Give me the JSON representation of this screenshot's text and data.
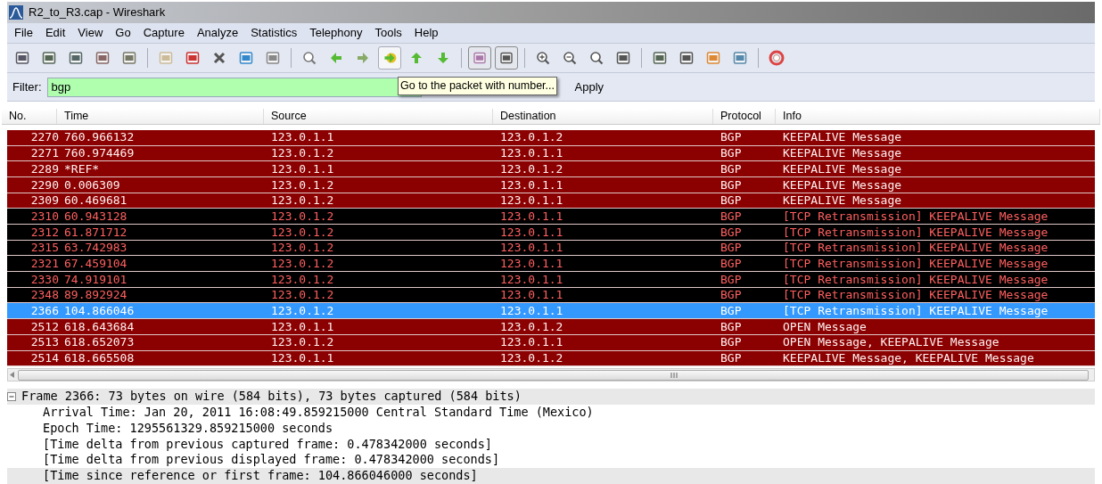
{
  "window": {
    "title": "R2_to_R3.cap - Wireshark"
  },
  "menu": [
    "File",
    "Edit",
    "View",
    "Go",
    "Capture",
    "Analyze",
    "Statistics",
    "Telephony",
    "Tools",
    "Help"
  ],
  "filter": {
    "label": "Filter:",
    "value": "bgp",
    "apply": "Apply"
  },
  "tooltip": "Go to the packet with number...",
  "columns": [
    "No.",
    "Time",
    "Source",
    "Destination",
    "Protocol",
    "Info"
  ],
  "rows": [
    {
      "kind": "normal",
      "selected": false,
      "cells": [
        "2270",
        "760.966132",
        "123.0.1.1",
        "123.0.1.2",
        "BGP",
        "KEEPALIVE Message"
      ]
    },
    {
      "kind": "normal",
      "selected": false,
      "cells": [
        "2271",
        "760.974469",
        "123.0.1.2",
        "123.0.1.1",
        "BGP",
        "KEEPALIVE Message"
      ]
    },
    {
      "kind": "normal",
      "selected": false,
      "cells": [
        "2289",
        "*REF*",
        "123.0.1.1",
        "123.0.1.2",
        "BGP",
        "KEEPALIVE Message"
      ]
    },
    {
      "kind": "normal",
      "selected": false,
      "cells": [
        "2290",
        "0.006309",
        "123.0.1.2",
        "123.0.1.1",
        "BGP",
        "KEEPALIVE Message"
      ]
    },
    {
      "kind": "normal",
      "selected": false,
      "cells": [
        "2309",
        "60.469681",
        "123.0.1.2",
        "123.0.1.1",
        "BGP",
        "KEEPALIVE Message"
      ]
    },
    {
      "kind": "error",
      "selected": false,
      "cells": [
        "2310",
        "60.943128",
        "123.0.1.2",
        "123.0.1.1",
        "BGP",
        "[TCP Retransmission] KEEPALIVE Message"
      ]
    },
    {
      "kind": "error",
      "selected": false,
      "cells": [
        "2312",
        "61.871712",
        "123.0.1.2",
        "123.0.1.1",
        "BGP",
        "[TCP Retransmission] KEEPALIVE Message"
      ]
    },
    {
      "kind": "error",
      "selected": false,
      "cells": [
        "2315",
        "63.742983",
        "123.0.1.2",
        "123.0.1.1",
        "BGP",
        "[TCP Retransmission] KEEPALIVE Message"
      ]
    },
    {
      "kind": "error",
      "selected": false,
      "cells": [
        "2321",
        "67.459104",
        "123.0.1.2",
        "123.0.1.1",
        "BGP",
        "[TCP Retransmission] KEEPALIVE Message"
      ]
    },
    {
      "kind": "error",
      "selected": false,
      "cells": [
        "2330",
        "74.919101",
        "123.0.1.2",
        "123.0.1.1",
        "BGP",
        "[TCP Retransmission] KEEPALIVE Message"
      ]
    },
    {
      "kind": "error",
      "selected": false,
      "cells": [
        "2348",
        "89.892924",
        "123.0.1.2",
        "123.0.1.1",
        "BGP",
        "[TCP Retransmission] KEEPALIVE Message"
      ]
    },
    {
      "kind": "error",
      "selected": true,
      "cells": [
        "2366",
        "104.866046",
        "123.0.1.2",
        "123.0.1.1",
        "BGP",
        "[TCP Retransmission] KEEPALIVE Message"
      ]
    },
    {
      "kind": "normal",
      "selected": false,
      "cells": [
        "2512",
        "618.643684",
        "123.0.1.1",
        "123.0.1.2",
        "BGP",
        "OPEN Message"
      ]
    },
    {
      "kind": "normal",
      "selected": false,
      "cells": [
        "2513",
        "618.652073",
        "123.0.1.2",
        "123.0.1.1",
        "BGP",
        "OPEN Message, KEEPALIVE Message"
      ]
    },
    {
      "kind": "normal",
      "selected": false,
      "cells": [
        "2514",
        "618.665508",
        "123.0.1.1",
        "123.0.1.2",
        "BGP",
        "KEEPALIVE Message, KEEPALIVE Message"
      ]
    }
  ],
  "details": {
    "label": "Frame 2366: 73 bytes on wire (584 bits), 73 bytes captured (584 bits)",
    "expanded": true,
    "selected": true,
    "children": [
      {
        "label": "Arrival Time: Jan 20, 2011 16:08:49.859215000 Central Standard Time (Mexico)",
        "selected": false
      },
      {
        "label": "Epoch Time: 1295561329.859215000 seconds",
        "selected": false
      },
      {
        "label": "[Time delta from previous captured frame: 0.478342000 seconds]",
        "selected": false
      },
      {
        "label": "[Time delta from previous displayed frame: 0.478342000 seconds]",
        "selected": false
      },
      {
        "label": "[Time since reference or first frame: 104.866046000 seconds]",
        "selected": true
      }
    ]
  }
}
